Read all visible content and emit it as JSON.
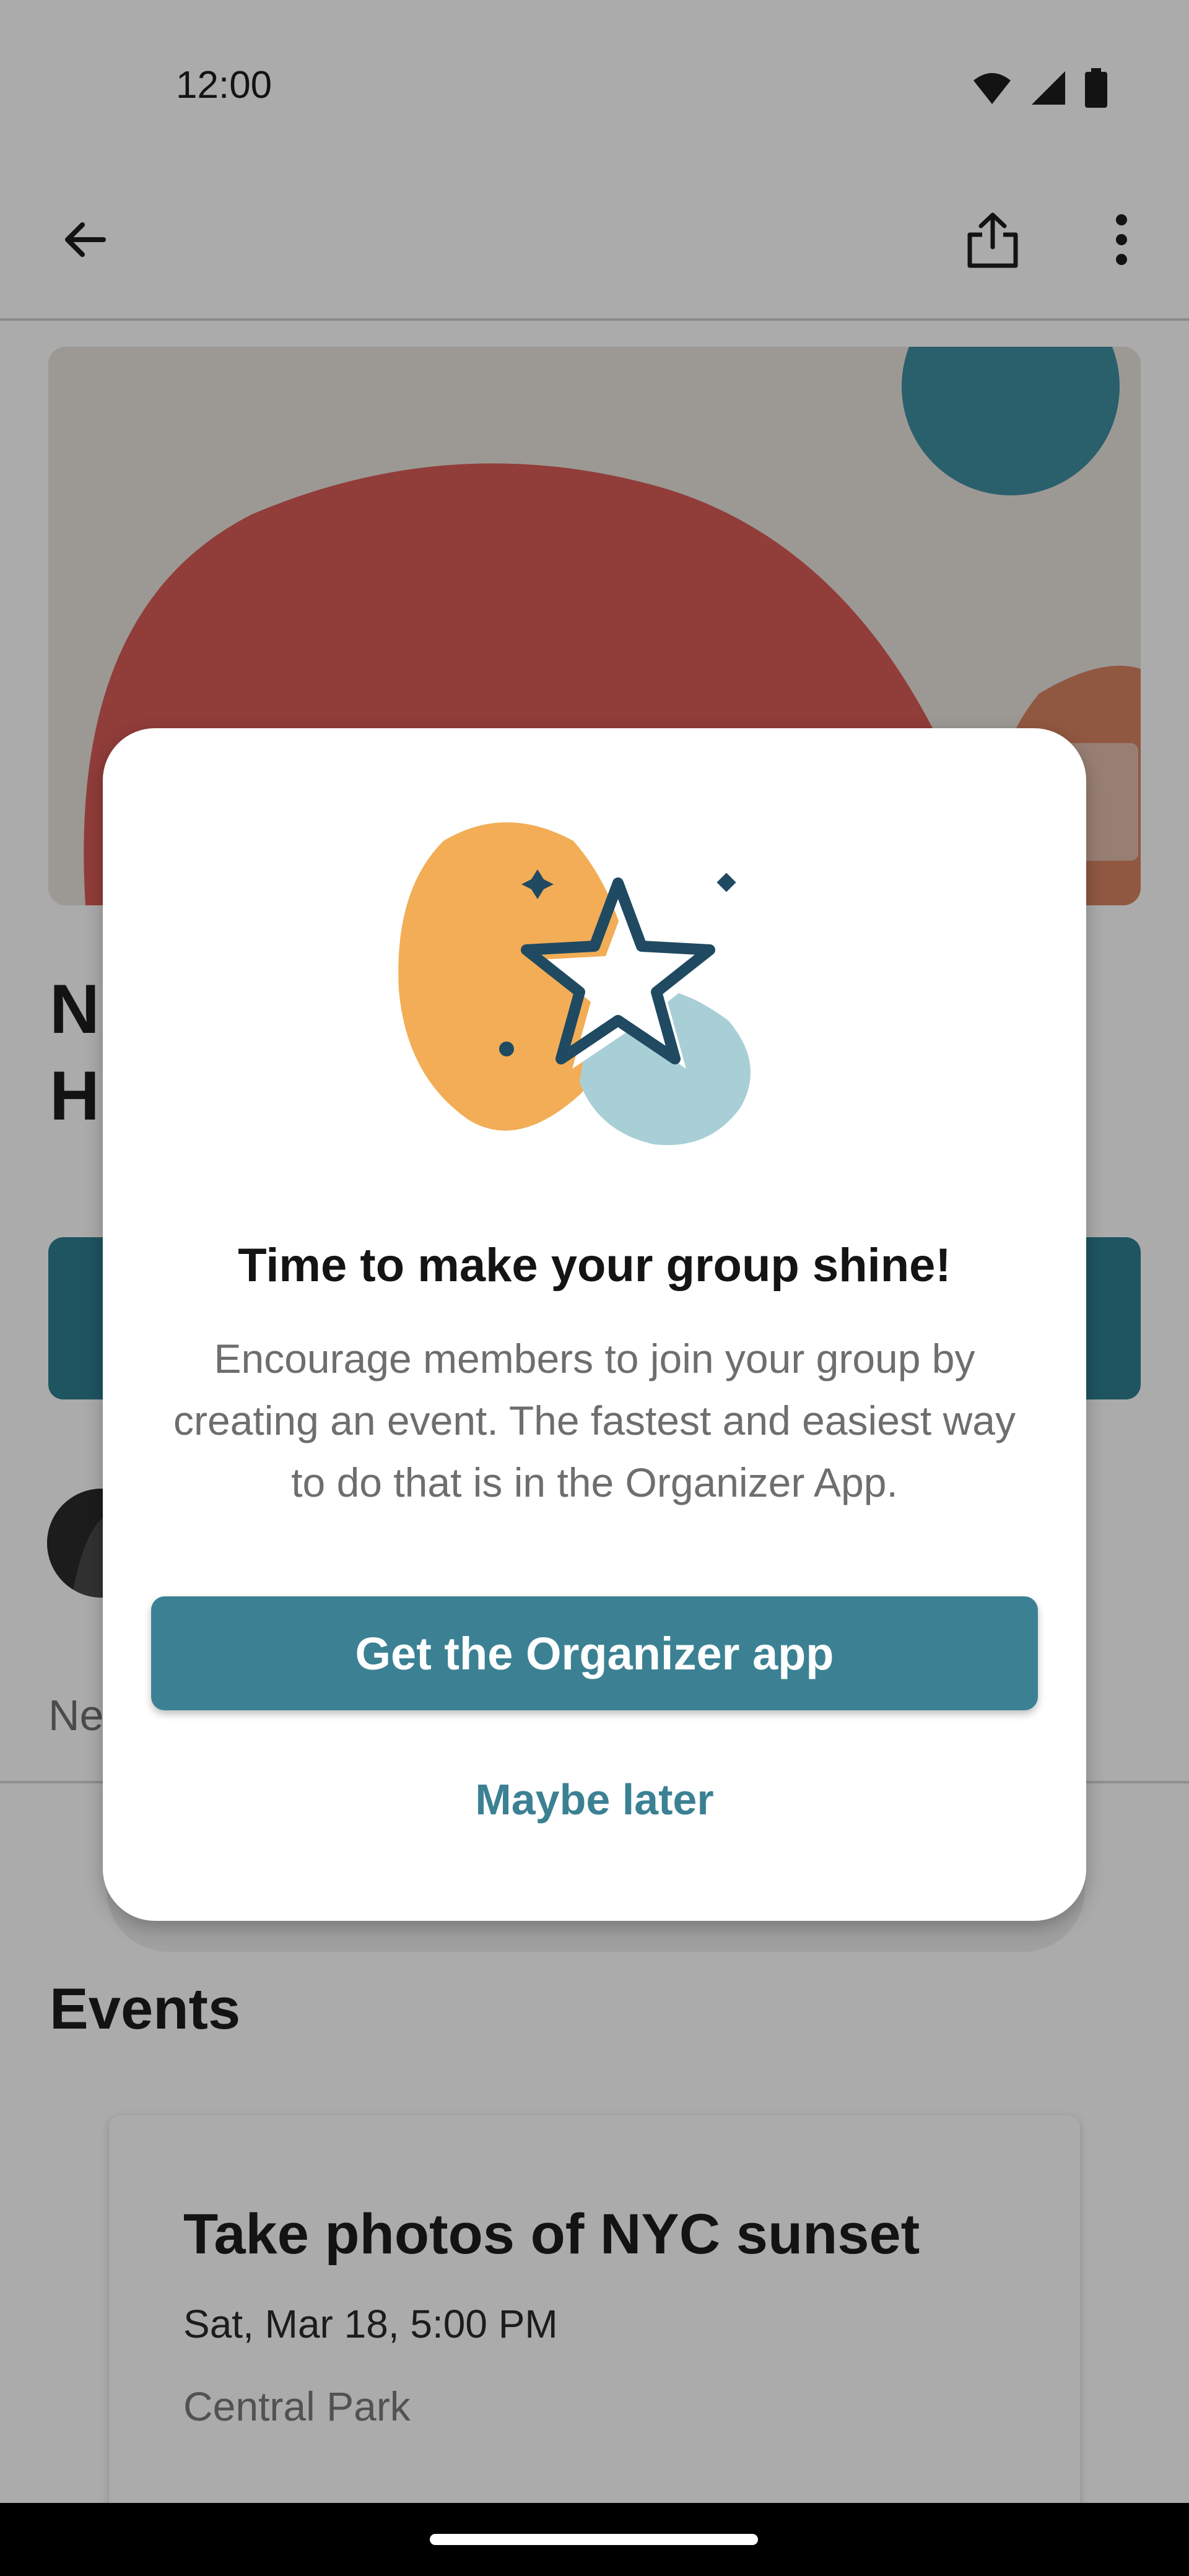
{
  "status_bar": {
    "time": "12:00"
  },
  "group": {
    "title_line1": "N",
    "title_line2": "H",
    "members_snippet": "Ne"
  },
  "events": {
    "heading": "Events",
    "items": [
      {
        "title": "Take photos of NYC sunset",
        "time": "Sat, Mar 18, 5:00 PM",
        "location": "Central Park"
      }
    ]
  },
  "dialog": {
    "title": "Time to make your group shine!",
    "body": "Encourage members to join your group by creating an event. The fastest and easiest way to do that is in the Organizer App.",
    "primary_button": "Get the Organizer app",
    "secondary_button": "Maybe later"
  },
  "colors": {
    "accent_teal": "#3b8193",
    "illustration_orange": "#f2ad56",
    "illustration_blue": "#a9cfd6",
    "star_outline": "#1f4a61",
    "hero_red": "#d95c57",
    "hero_teal": "#3f8ea1"
  }
}
